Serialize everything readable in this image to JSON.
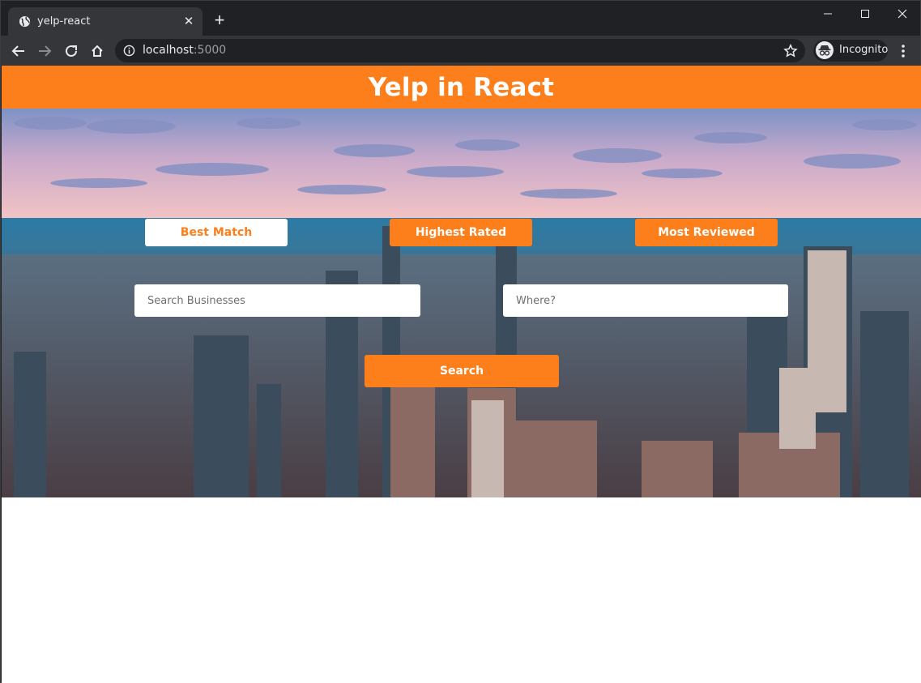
{
  "browser": {
    "tab_title": "yelp-react",
    "url_host": "localhost",
    "url_port": ":5000",
    "profile_label": "Incognito",
    "icons": {
      "favicon": "globe-icon",
      "tab_close": "close-icon",
      "new_tab": "plus-icon",
      "back": "back-arrow-icon",
      "forward": "forward-arrow-icon",
      "reload": "reload-icon",
      "home": "home-icon",
      "site_info": "info-icon",
      "bookmark": "star-icon",
      "menu": "kebab-menu-icon"
    }
  },
  "page": {
    "title": "Yelp in React",
    "accent_color": "#fd7f1c",
    "sort_options": [
      {
        "label": "Best Match",
        "active": true
      },
      {
        "label": "Highest Rated",
        "active": false
      },
      {
        "label": "Most Reviewed",
        "active": false
      }
    ],
    "search": {
      "term_placeholder": "Search Businesses",
      "location_placeholder": "Where?",
      "button_label": "Search"
    }
  }
}
